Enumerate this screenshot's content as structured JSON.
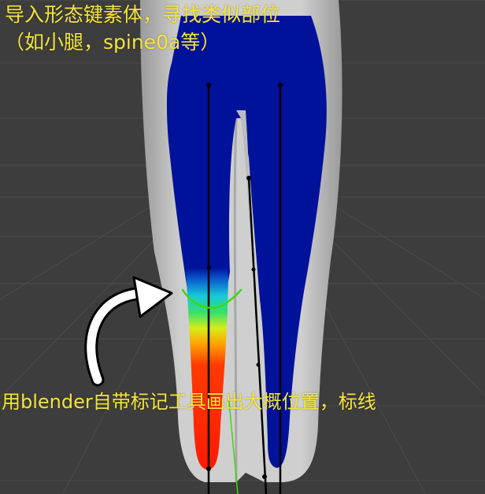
{
  "annotations": {
    "line1": "导入形态键素体，寻找类似部位",
    "line2": "（如小腿，spine0a等）",
    "line3": "用blender自带标记工具画出大概位置，标线"
  },
  "colors": {
    "viewport_background": "#3d3d3d",
    "grid_line": "#4a4a4a",
    "mesh_grey": "#c9c9c9",
    "weight_blue": "#00129a",
    "weight_red": "#ff1a00",
    "caption_yellow": "#f5e53a",
    "annotation_green": "#3fd616",
    "bone_line": "#000000"
  },
  "icons": {
    "arrow": "curved-arrow-icon"
  }
}
